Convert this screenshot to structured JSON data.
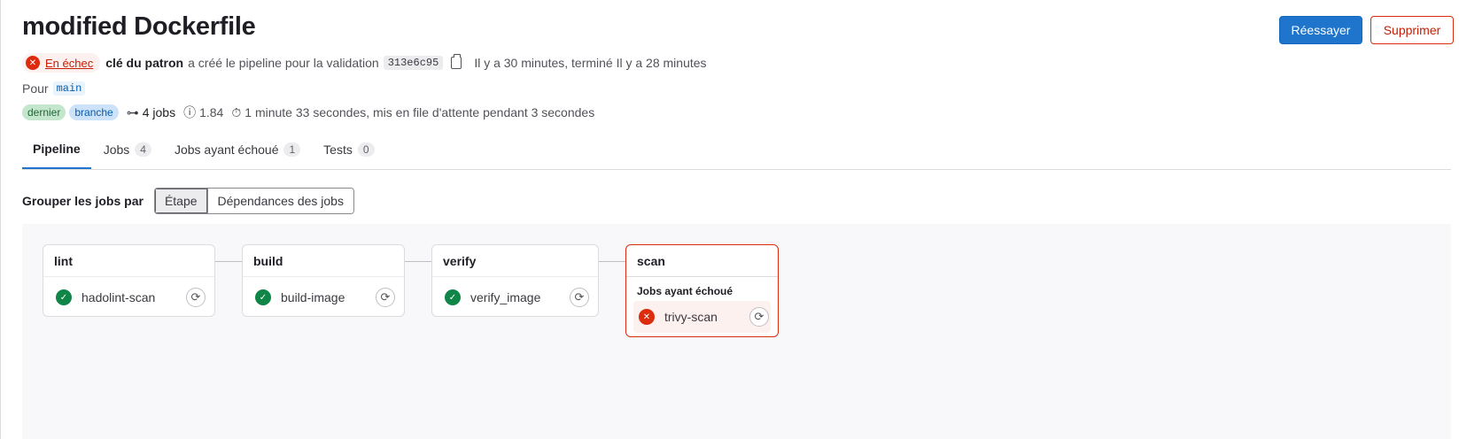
{
  "header": {
    "title": "modified Dockerfile",
    "retry_label": "Réessayer",
    "delete_label": "Supprimer"
  },
  "pipeline_info": {
    "status": "En échec",
    "author": "clé du patron",
    "created_text": "a créé le pipeline pour la validation",
    "commit_sha": "313e6c95",
    "timing": "Il y a 30 minutes, terminé Il y a 28 minutes",
    "for_label": "Pour",
    "ref": "main",
    "tags": [
      "dernier",
      "branche"
    ],
    "jobs_count": "4 jobs",
    "version": "1.84",
    "duration": "1 minute 33 secondes, mis en file d'attente pendant 3 secondes"
  },
  "tabs": [
    {
      "label": "Pipeline",
      "count": null
    },
    {
      "label": "Jobs",
      "count": "4"
    },
    {
      "label": "Jobs ayant échoué",
      "count": "1"
    },
    {
      "label": "Tests",
      "count": "0"
    }
  ],
  "grouping": {
    "label": "Grouper les jobs par",
    "options": [
      "Étape",
      "Dépendances des jobs"
    ],
    "selected": "Étape"
  },
  "stages": [
    {
      "name": "lint",
      "jobs": [
        {
          "name": "hadolint-scan",
          "status": "success"
        }
      ]
    },
    {
      "name": "build",
      "jobs": [
        {
          "name": "build-image",
          "status": "success"
        }
      ]
    },
    {
      "name": "verify",
      "jobs": [
        {
          "name": "verify_image",
          "status": "success"
        }
      ]
    },
    {
      "name": "scan",
      "failed_label": "Jobs ayant échoué",
      "jobs": [
        {
          "name": "trivy-scan",
          "status": "failed"
        }
      ]
    }
  ],
  "colors": {
    "primary": "#1f75cb",
    "danger": "#dd2b0e",
    "success": "#108548"
  },
  "icons": {
    "status_failed": "x-circle-icon",
    "status_success": "check-circle-icon",
    "copy": "copy-icon",
    "jobs": "link-icon",
    "version": "info-icon",
    "duration": "timer-icon",
    "retry": "retry-icon"
  }
}
